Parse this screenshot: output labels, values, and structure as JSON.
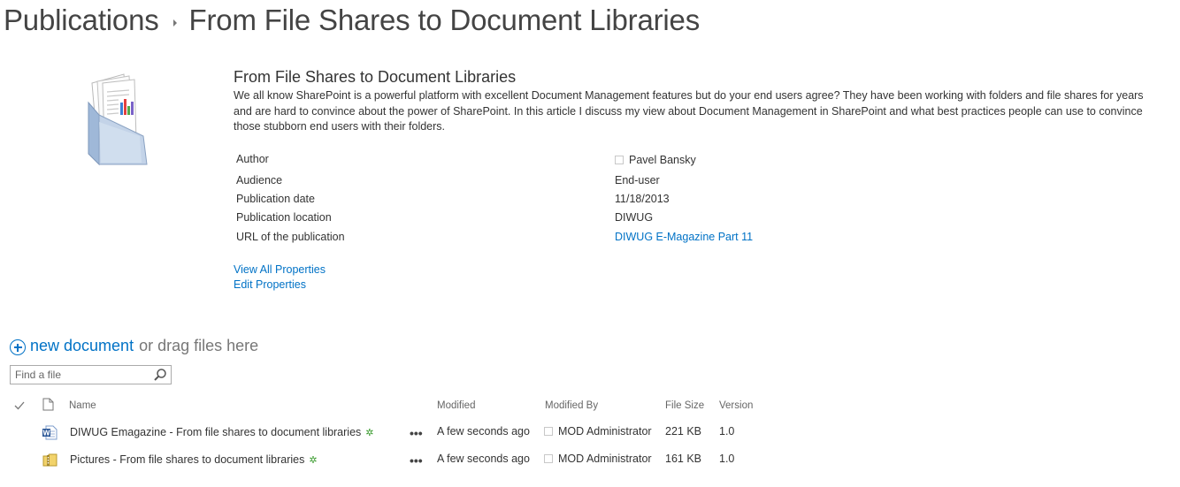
{
  "breadcrumb": {
    "items": [
      "Publications",
      "From File Shares to Document Libraries"
    ]
  },
  "publication": {
    "title": "From File Shares to Document Libraries",
    "description": "We all know SharePoint is a powerful platform with excellent Document Management features but do your end users agree? They have been working with folders and file shares for years and are hard to convince about the power of SharePoint. In this article I discuss my view about Document Management in SharePoint and what best practices people can use to convince those stubborn end users with their folders.",
    "properties": [
      {
        "label": "Author",
        "value": "Pavel Bansky"
      },
      {
        "label": "Audience",
        "value": "End-user"
      },
      {
        "label": "Publication date",
        "value": "11/18/2013"
      },
      {
        "label": "Publication location",
        "value": "DIWUG"
      },
      {
        "label": "URL of the publication",
        "value": "DIWUG E-Magazine Part 11"
      }
    ],
    "actions": {
      "view_all": "View All Properties",
      "edit": "Edit Properties"
    }
  },
  "library": {
    "new_document_label": "new document",
    "drag_label": "or drag files here",
    "search_placeholder": "Find a file",
    "columns": {
      "name": "Name",
      "modified": "Modified",
      "modified_by": "Modified By",
      "file_size": "File Size",
      "version": "Version"
    },
    "rows": [
      {
        "icon": "word-document-icon",
        "name": "DIWUG Emagazine - From file shares to document libraries",
        "modified": "A few seconds ago",
        "modified_by": "MOD Administrator",
        "file_size": "221 KB",
        "version": "1.0"
      },
      {
        "icon": "zip-folder-icon",
        "name": "Pictures - From file shares to document libraries",
        "modified": "A few seconds ago",
        "modified_by": "MOD Administrator",
        "file_size": "161 KB",
        "version": "1.0"
      }
    ],
    "new_marker": "✲",
    "ellipsis": "•••"
  },
  "colors": {
    "link": "#0072c6",
    "text": "#333333",
    "new_marker": "#3a9b2e"
  }
}
